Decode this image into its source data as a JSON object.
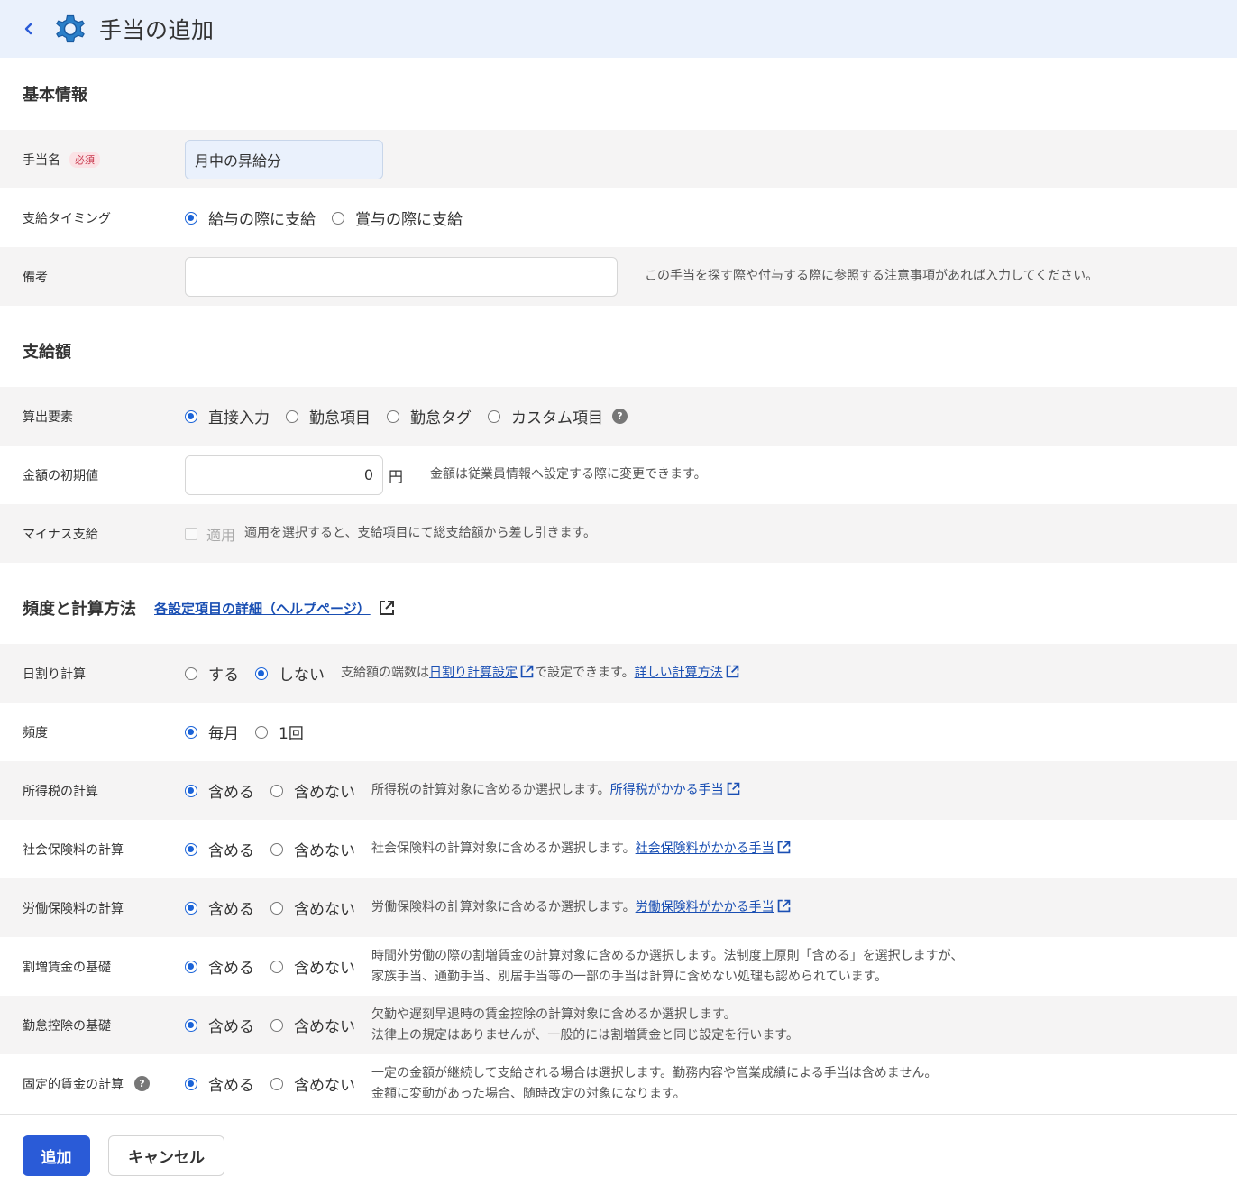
{
  "header": {
    "title": "手当の追加"
  },
  "basic": {
    "heading": "基本情報",
    "name_label": "手当名",
    "required_badge": "必須",
    "name_value": "月中の昇給分",
    "timing_label": "支給タイミング",
    "timing_options": [
      "給与の際に支給",
      "賞与の際に支給"
    ],
    "note_label": "備考",
    "note_value": "",
    "note_hint": "この手当を探す際や付与する際に参照する注意事項があれば入力してください。"
  },
  "amount": {
    "heading": "支給額",
    "calc_label": "算出要素",
    "calc_options": [
      "直接入力",
      "勤怠項目",
      "勤怠タグ",
      "カスタム項目"
    ],
    "initial_label": "金額の初期値",
    "initial_value": "0",
    "unit": "円",
    "initial_hint": "金額は従業員情報へ設定する際に変更できます。",
    "minus_label": "マイナス支給",
    "minus_check_label": "適用",
    "minus_hint": "適用を選択すると、支給項目にて総支給額から差し引きます。"
  },
  "freq": {
    "heading": "頻度と計算方法",
    "help_link": "各設定項目の詳細（ヘルプページ）",
    "daily_label": "日割り計算",
    "daily_options": [
      "する",
      "しない"
    ],
    "daily_hint_pre": "支給額の端数は",
    "daily_hint_link1": "日割り計算設定",
    "daily_hint_mid": "で設定できます。",
    "daily_hint_link2": "詳しい計算方法",
    "frequency_label": "頻度",
    "frequency_options": [
      "毎月",
      "1回"
    ],
    "include_opt": "含める",
    "exclude_opt": "含めない",
    "income_tax_label": "所得税の計算",
    "income_tax_hint": "所得税の計算対象に含めるか選択します。",
    "income_tax_link": "所得税がかかる手当",
    "social_label": "社会保険料の計算",
    "social_hint": "社会保険料の計算対象に含めるか選択します。",
    "social_link": "社会保険料がかかる手当",
    "labor_label": "労働保険料の計算",
    "labor_hint": "労働保険料の計算対象に含めるか選択します。",
    "labor_link": "労働保険料がかかる手当",
    "overtime_label": "割増賃金の基礎",
    "overtime_hint1": "時間外労働の際の割増賃金の計算対象に含めるか選択します。法制度上原則「含める」を選択しますが、",
    "overtime_hint2": "家族手当、通勤手当、別居手当等の一部の手当は計算に含めない処理も認められています。",
    "deduction_label": "勤怠控除の基礎",
    "deduction_hint1": "欠勤や遅刻早退時の賃金控除の計算対象に含めるか選択します。",
    "deduction_hint2": "法律上の規定はありませんが、一般的には割増賃金と同じ設定を行います。",
    "fixed_label": "固定的賃金の計算",
    "fixed_hint1": "一定の金額が継続して支給される場合は選択します。勤務内容や営業成績による手当は含めません。",
    "fixed_hint2": "金額に変動があった場合、随時改定の対象になります。"
  },
  "footer": {
    "add_label": "追加",
    "cancel_label": "キャンセル"
  },
  "colors": {
    "primary": "#2a5bd7",
    "header_bg": "#eaf1fc",
    "row_bg": "#f5f4f4"
  }
}
